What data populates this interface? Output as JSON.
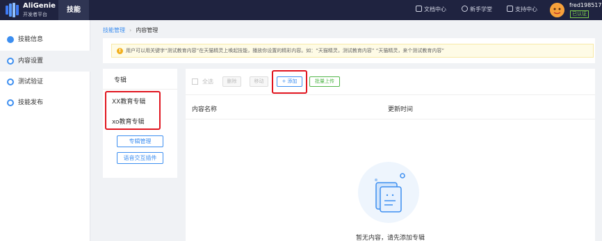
{
  "brand": {
    "title": "AliGenie",
    "subtitle": "开发者平台"
  },
  "topnav": {
    "active": "技能",
    "docs": "文档中心",
    "newbie": "新手学堂",
    "support": "支持中心",
    "user": "fred198517",
    "verified": "已认证"
  },
  "sidebar": {
    "items": [
      {
        "label": "技能信息"
      },
      {
        "label": "内容设置"
      },
      {
        "label": "测试验证"
      },
      {
        "label": "技能发布"
      }
    ]
  },
  "breadcrumb": {
    "parent": "技能管理",
    "current": "内容管理"
  },
  "notice": {
    "text": "用户可以用关键字“测试教育内容”在天猫精灵上唤起技能，播放你设置的精彩内容。如：“天猫精灵，测试教育内容” “天猫精灵，来个测试教育内容”"
  },
  "albums": {
    "title": "专辑",
    "items": [
      "XX教育专辑",
      "xo教育专辑"
    ],
    "manage_button": "专辑管理",
    "plugin_button": "语音交互插件"
  },
  "toolbar": {
    "select_all": "全选",
    "delete": "删除",
    "move": "移动",
    "add": "+ 添加",
    "batch_upload": "批量上传"
  },
  "table": {
    "columns": [
      "内容名称",
      "更新时间"
    ]
  },
  "empty": {
    "text": "暂无内容，请先添加专辑"
  },
  "colors": {
    "topbar": "#1f2340",
    "accent": "#3c8ef0",
    "highlight": "#e0141e",
    "success": "#52b64a"
  }
}
